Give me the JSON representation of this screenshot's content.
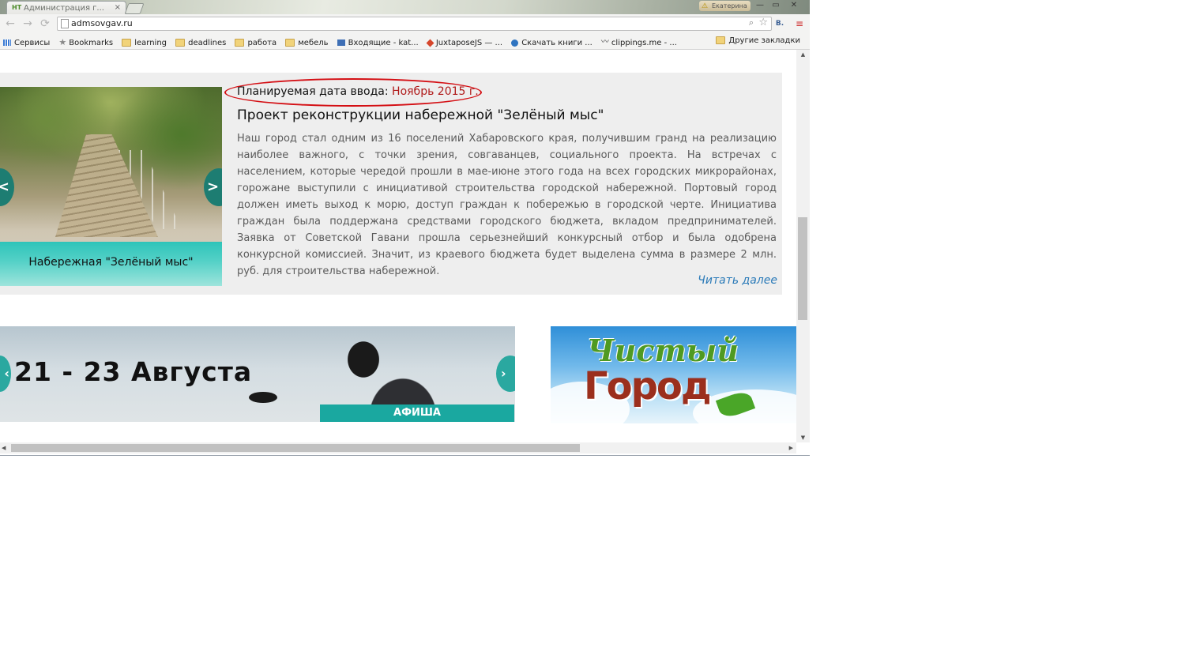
{
  "browser": {
    "tab_title": "Администрация г...",
    "tab_close": "×",
    "favicon_text": "НТ",
    "user_name": "Екатерина",
    "window_controls": {
      "minimize": "—",
      "maximize": "▭",
      "close": "✕"
    },
    "nav": {
      "back": "←",
      "forward": "→",
      "reload": "⟳"
    },
    "address": "admsovgav.ru",
    "extension_label": "В.",
    "menu_glyph": "≡"
  },
  "bookmarks": {
    "items": [
      {
        "label": "Сервисы",
        "icon": "apps-grid-icon"
      },
      {
        "label": "Bookmarks",
        "icon": "star-icon"
      },
      {
        "label": "learning",
        "icon": "folder-icon"
      },
      {
        "label": "deadlines",
        "icon": "folder-icon"
      },
      {
        "label": "работа",
        "icon": "folder-icon"
      },
      {
        "label": "мебель",
        "icon": "folder-icon"
      },
      {
        "label": "Входящие - kat...",
        "icon": "mail-icon"
      },
      {
        "label": "JuxtaposeJS — ...",
        "icon": "diamond-icon"
      },
      {
        "label": "Скачать книги ...",
        "icon": "globe-icon"
      },
      {
        "label": "clippings.me - ...",
        "icon": "wave-icon"
      }
    ],
    "more": "»",
    "other": "Другие закладки"
  },
  "news": {
    "planned_label": "Планируемая дата ввода:",
    "planned_date": "Ноябрь 2015 г.",
    "title": "Проект реконструкции набережной \"Зелёный мыс\"",
    "text": "Наш город стал одним из 16 поселений Хабаровского края, получившим гранд на реализацию наиболее важного, с точки зрения, совгаванцев, социального проекта. На встречах с населением, которые чередой прошли в мае-июне этого года на всех городских микрорайонах, горожане выступили с инициативой строительства городской набережной. Портовый город должен иметь выход к морю, доступ граждан к побережью в городской черте. Инициатива граждан была поддержана средствами городского бюджета, вкладом предпринимателей. Заявка от Советской Гавани прошла серьезнейший конкурсный отбор и была одобрена конкурсной комиссией. Значит, из краевого бюджета будет выделена сумма в размере 2 млн. руб. для строительства набережной.",
    "read_more": "Читать далее",
    "slider_caption": "Набережная \"Зелёный мыс\"",
    "prev": "<",
    "next": ">"
  },
  "afisha": {
    "date_text": "21 - 23 Августа",
    "label": "АФИША",
    "prev": "‹",
    "next": "›"
  },
  "clean_city": {
    "line1": "Чистый",
    "line2": "Город"
  },
  "colors": {
    "accent_teal": "#1aa8a0",
    "date_red": "#b01a1a",
    "annotation_red": "#d40f14",
    "link_blue": "#2a7ab8"
  }
}
